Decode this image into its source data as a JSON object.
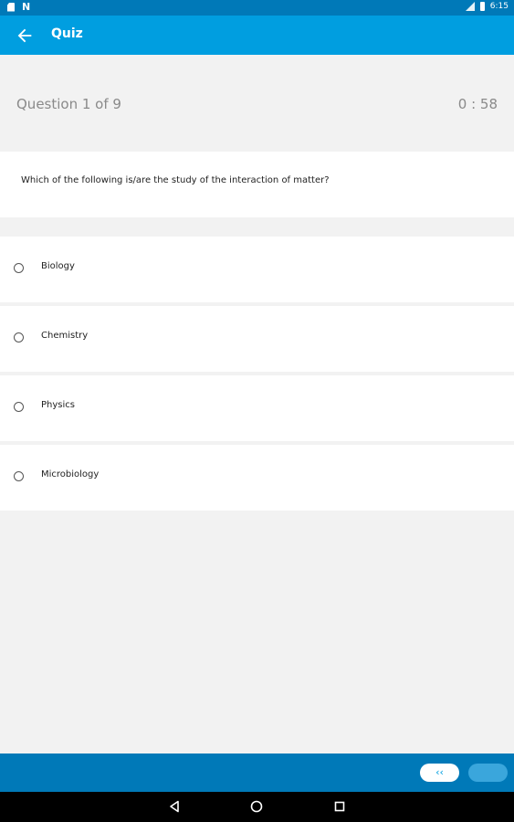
{
  "status_bar": {
    "time": "6:15",
    "left_icons": [
      "sd-card-icon",
      "n-icon"
    ],
    "right_icons": [
      "signal-icon",
      "battery-icon"
    ]
  },
  "app_bar": {
    "title": "Quiz",
    "back_icon": "arrow-left-icon",
    "color": "#009ee0"
  },
  "quiz": {
    "counter": "Question 1 of  9",
    "timer": "0 : 58",
    "question": "Which of the following is/are the study of the interaction of matter?",
    "options": [
      {
        "label": "Biology",
        "selected": false
      },
      {
        "label": "Chemistry",
        "selected": false
      },
      {
        "label": "Physics",
        "selected": false
      },
      {
        "label": "Microbiology",
        "selected": false
      }
    ]
  },
  "bottom_bar": {
    "prev_label": "‹‹",
    "color": "#0079b8"
  },
  "nav_bar": {
    "icons": [
      "back-triangle-icon",
      "home-circle-icon",
      "recents-square-icon"
    ]
  }
}
